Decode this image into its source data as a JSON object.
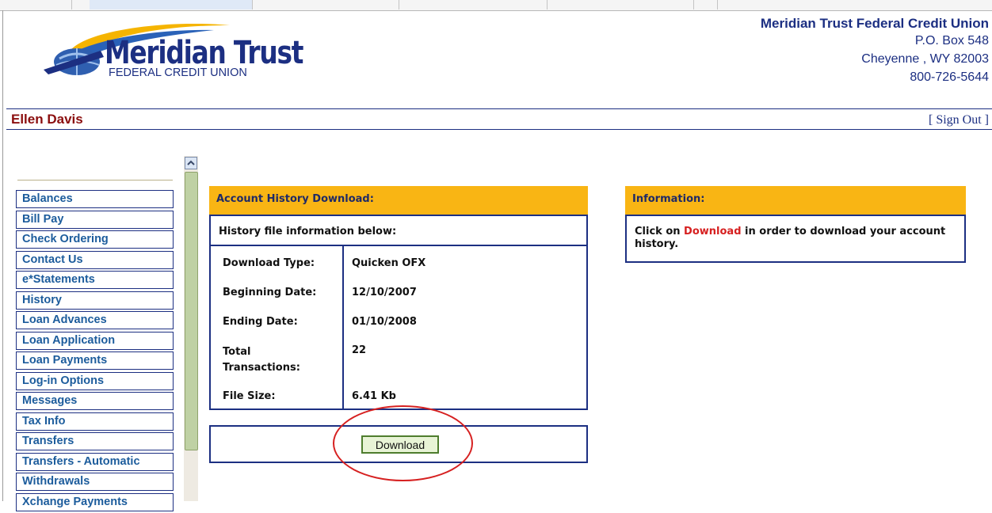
{
  "brand": {
    "logo_main": "Meridian Trust",
    "logo_sub": "FEDERAL CREDIT UNION",
    "name": "Meridian Trust Federal Credit Union",
    "address_line1": "P.O. Box 548",
    "address_line2": "Cheyenne , WY 82003",
    "phone": "800-726-5644"
  },
  "user": {
    "name": "Ellen Davis"
  },
  "signout": {
    "open": "[ ",
    "label": "Sign Out",
    "close": " ]"
  },
  "nav": {
    "items": [
      {
        "label": "Balances"
      },
      {
        "label": "Bill Pay"
      },
      {
        "label": "Check Ordering"
      },
      {
        "label": "Contact Us"
      },
      {
        "label": "e*Statements"
      },
      {
        "label": "History"
      },
      {
        "label": "Loan Advances"
      },
      {
        "label": "Loan Application"
      },
      {
        "label": "Loan Payments"
      },
      {
        "label": "Log-in Options"
      },
      {
        "label": "Messages"
      },
      {
        "label": "Tax Info"
      },
      {
        "label": "Transfers"
      },
      {
        "label": "Transfers - Automatic"
      },
      {
        "label": "Withdrawals"
      },
      {
        "label": "Xchange Payments"
      }
    ]
  },
  "history": {
    "title": "Account History Download:",
    "subtitle": "History file information below:",
    "rows": [
      {
        "label": "Download Type:",
        "value": "Quicken OFX"
      },
      {
        "label": "Beginning Date:",
        "value": "12/10/2007"
      },
      {
        "label": "Ending Date:",
        "value": "01/10/2008"
      },
      {
        "label": "Total Transactions:",
        "value": "22"
      },
      {
        "label": "File Size:",
        "value": "6.41 Kb"
      }
    ],
    "download_label": "Download"
  },
  "info": {
    "title": "Information:",
    "text_before": "Click on ",
    "text_highlight": "Download",
    "text_after": " in order to download your account history."
  },
  "colors": {
    "navy": "#1c2f82",
    "gold": "#f9b514",
    "user_red": "#8b0e0e",
    "highlight_red": "#d62020"
  }
}
